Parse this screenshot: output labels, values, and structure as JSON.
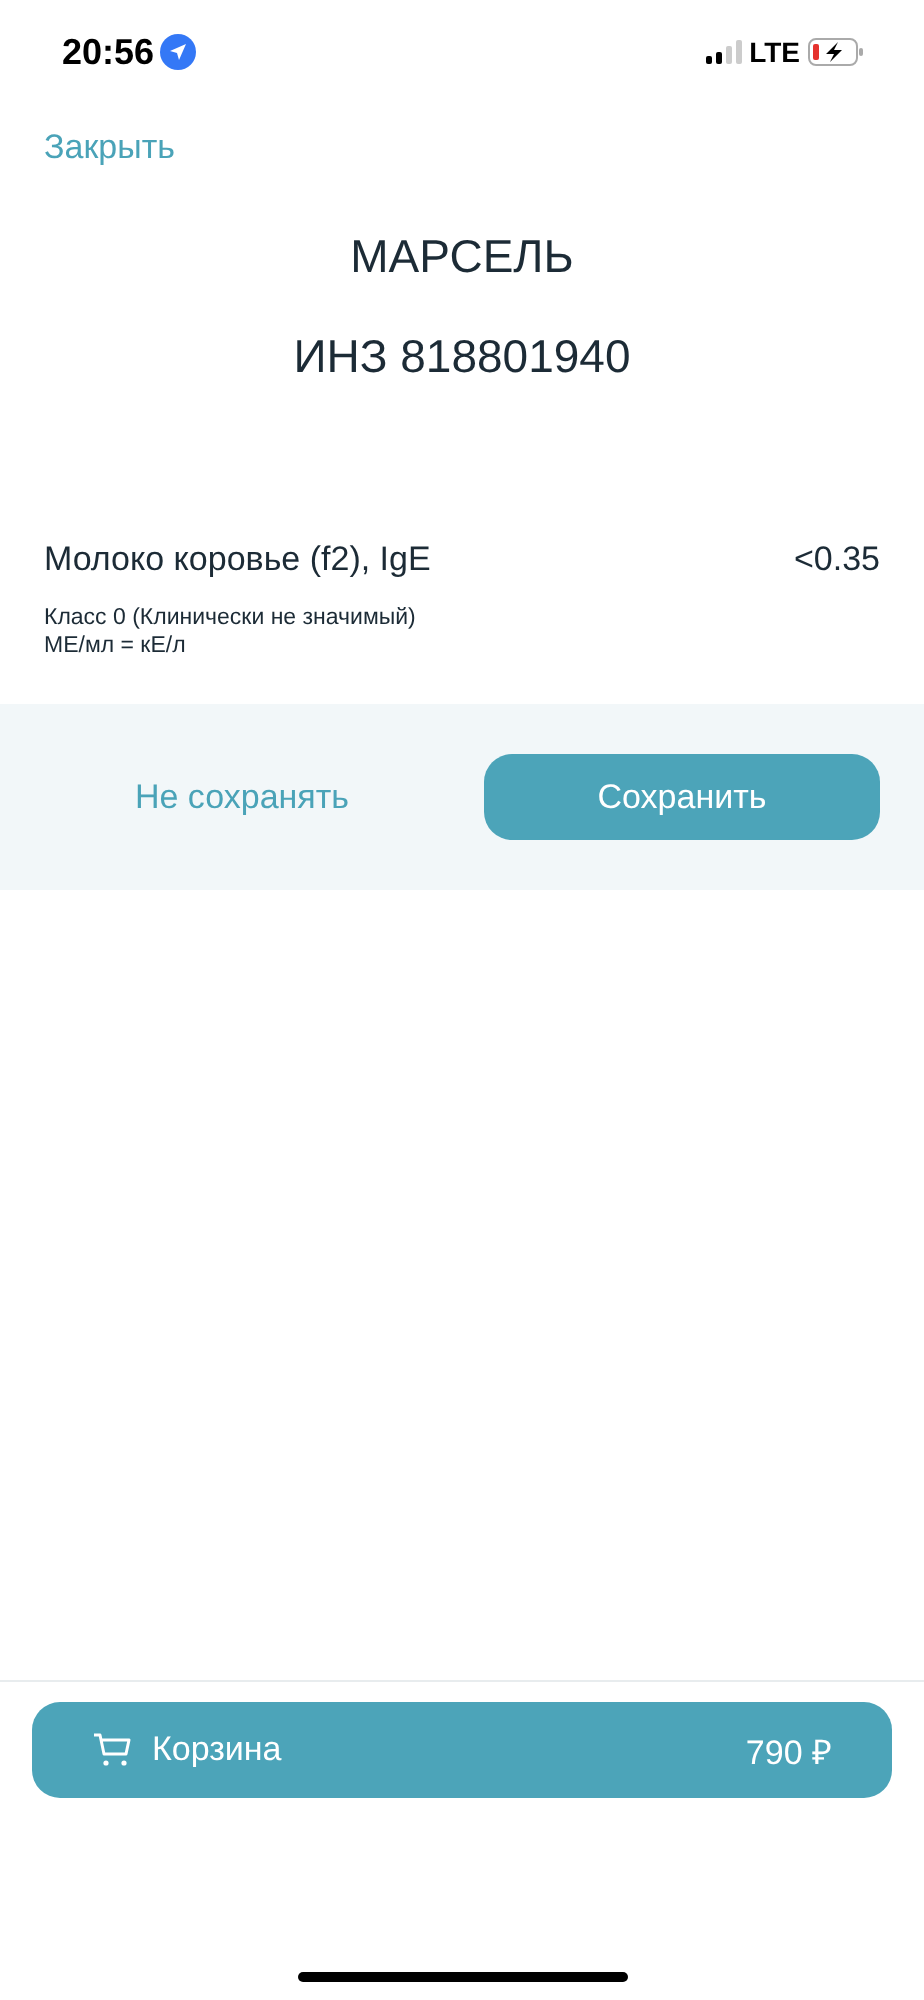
{
  "status_bar": {
    "time": "20:56",
    "network": "LTE"
  },
  "close_link": "Закрыть",
  "patient": {
    "name": "МАРСЕЛЬ",
    "id": "ИНЗ 818801940"
  },
  "result": {
    "test": "Молоко коровье (f2), IgE",
    "value": "<0.35",
    "notes": [
      "Класс 0 (Клинически не значимый)",
      "МЕ/мл = кЕ/л"
    ]
  },
  "actions": [
    {
      "label": "Не сохранять",
      "kind": "secondary"
    },
    {
      "label": "Сохранить",
      "kind": "primary"
    }
  ],
  "cart": {
    "label": "Корзина",
    "total": "790 ₽"
  }
}
